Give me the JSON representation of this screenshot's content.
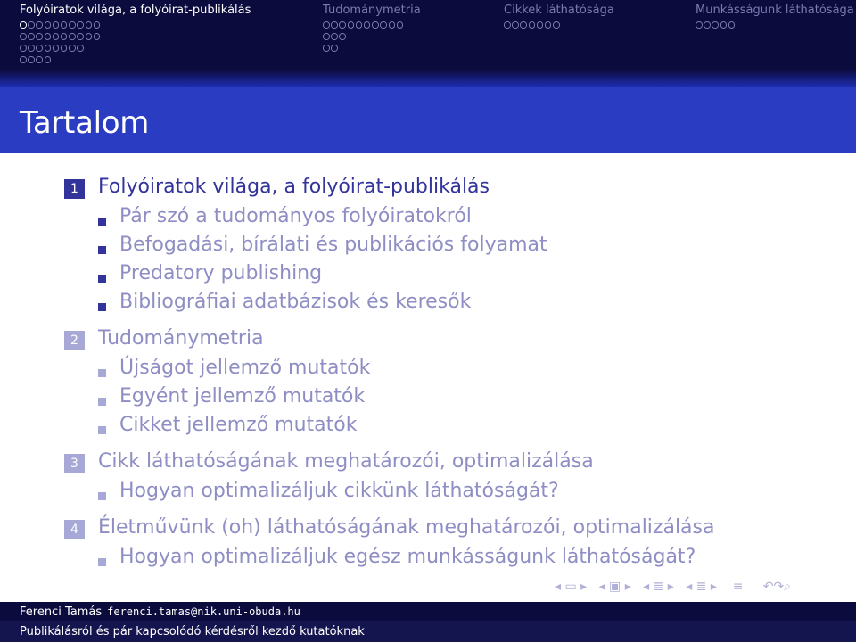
{
  "nav": {
    "sections": [
      {
        "label": "Folyóiratok világa, a folyóirat-publikálás",
        "active": true
      },
      {
        "label": "Tudománymetria",
        "active": false
      },
      {
        "label": "Cikkek láthatósága",
        "active": false
      },
      {
        "label": "Munkásságunk láthatósága",
        "active": false
      }
    ]
  },
  "frame_title": "Tartalom",
  "toc": [
    {
      "number": "1",
      "title": "Folyóiratok világa, a folyóirat-publikálás",
      "subsections": [
        "Pár szó a tudományos folyóiratokról",
        "Befogadási, bírálati és publikációs folyamat",
        "Predatory publishing",
        "Bibliográfiai adatbázisok és keresők"
      ]
    },
    {
      "number": "2",
      "title": "Tudománymetria",
      "subsections": [
        "Újságot jellemző mutatók",
        "Egyént jellemző mutatók",
        "Cikket jellemző mutatók"
      ]
    },
    {
      "number": "3",
      "title": "Cikk láthatóságának meghatározói, optimalizálása",
      "subsections": [
        "Hogyan optimalizáljuk cikkünk láthatóságát?"
      ]
    },
    {
      "number": "4",
      "title": "Életművünk (oh) láthatóságának meghatározói, optimalizálása",
      "subsections": [
        "Hogyan optimalizáljuk egész munkásságunk láthatóságát?"
      ]
    }
  ],
  "footer": {
    "author": "Ferenci Tamás",
    "email": "ferenci.tamas@nik.uni-obuda.hu",
    "talk_title": "Publikálásról és pár kapcsolódó kérdésről kezdő kutatóknak"
  },
  "colors": {
    "header_bg": "#0b0b3e",
    "title_bg": "#2a3cc2",
    "accent": "#33339c",
    "shaded": "#8e8ec4"
  }
}
